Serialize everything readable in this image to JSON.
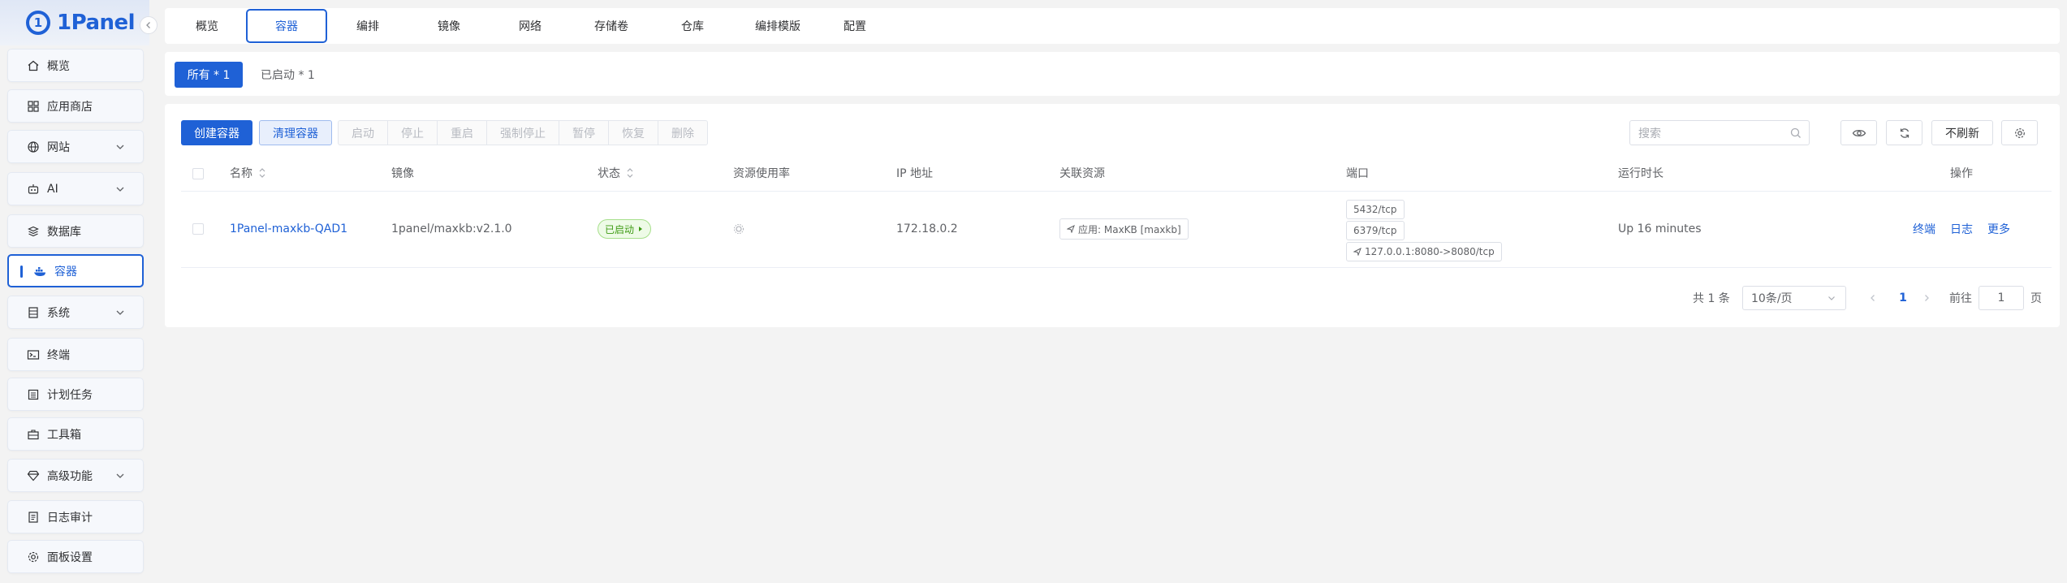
{
  "app": {
    "name": "1Panel"
  },
  "sidebar": {
    "items": [
      {
        "label": "概览",
        "icon": "home-icon"
      },
      {
        "label": "应用商店",
        "icon": "grid-icon"
      },
      {
        "label": "网站",
        "icon": "globe-icon"
      },
      {
        "label": "AI",
        "icon": "robot-icon"
      },
      {
        "label": "数据库",
        "icon": "database-icon"
      },
      {
        "label": "容器",
        "icon": "docker-icon"
      },
      {
        "label": "系统",
        "icon": "server-icon"
      },
      {
        "label": "终端",
        "icon": "terminal-icon"
      },
      {
        "label": "计划任务",
        "icon": "list-icon"
      },
      {
        "label": "工具箱",
        "icon": "toolbox-icon"
      },
      {
        "label": "高级功能",
        "icon": "diamond-icon"
      },
      {
        "label": "日志审计",
        "icon": "log-icon"
      },
      {
        "label": "面板设置",
        "icon": "gear-icon"
      }
    ]
  },
  "top_tabs": [
    {
      "label": "概览"
    },
    {
      "label": "容器"
    },
    {
      "label": "编排"
    },
    {
      "label": "镜像"
    },
    {
      "label": "网络"
    },
    {
      "label": "存储卷"
    },
    {
      "label": "仓库"
    },
    {
      "label": "编排模版"
    },
    {
      "label": "配置"
    }
  ],
  "filters": {
    "all": "所有 * 1",
    "running": "已启动 * 1"
  },
  "toolbar": {
    "create": "创建容器",
    "clean": "清理容器",
    "actions": [
      "启动",
      "停止",
      "重启",
      "强制停止",
      "暂停",
      "恢复",
      "删除"
    ],
    "search_placeholder": "搜索",
    "no_refresh": "不刷新"
  },
  "table": {
    "headers": {
      "name": "名称",
      "image": "镜像",
      "status": "状态",
      "resource_usage": "资源使用率",
      "ip": "IP 地址",
      "related": "关联资源",
      "ports": "端口",
      "uptime": "运行时长",
      "ops": "操作"
    },
    "rows": [
      {
        "name": "1Panel-maxkb-QAD1",
        "image": "1panel/maxkb:v2.1.0",
        "status": "已启动",
        "ip": "172.18.0.2",
        "related": "应用: MaxKB [maxkb]",
        "ports": [
          "5432/tcp",
          "6379/tcp",
          "127.0.0.1:8080->8080/tcp"
        ],
        "uptime": "Up 16 minutes",
        "ops": [
          "终端",
          "日志",
          "更多"
        ]
      }
    ]
  },
  "pagination": {
    "total": "共 1 条",
    "page_size": "10条/页",
    "current": "1",
    "goto_label": "前往",
    "goto_value": "1",
    "page_suffix": "页"
  },
  "colors": {
    "primary": "#1f61d6",
    "success": "#3e9b14"
  }
}
